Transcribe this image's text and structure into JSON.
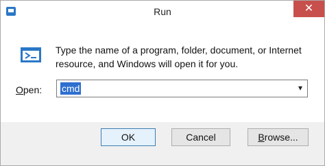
{
  "window": {
    "title": "Run"
  },
  "content": {
    "description": "Type the name of a program, folder, document, or Internet resource, and Windows will open it for you.",
    "open_label_prefix": "O",
    "open_label_rest": "pen:",
    "open_value": "cmd"
  },
  "buttons": {
    "ok": "OK",
    "cancel": "Cancel",
    "browse_prefix": "B",
    "browse_rest": "rowse..."
  },
  "icons": {
    "app": "run-app-icon",
    "run": "run-program-icon",
    "close": "close-icon",
    "dropdown": "chevron-down-icon"
  },
  "colors": {
    "close_button": "#c7504c",
    "selection": "#2e6fd0",
    "window_background": "#f0f0f0",
    "content_background": "#ffffff"
  }
}
